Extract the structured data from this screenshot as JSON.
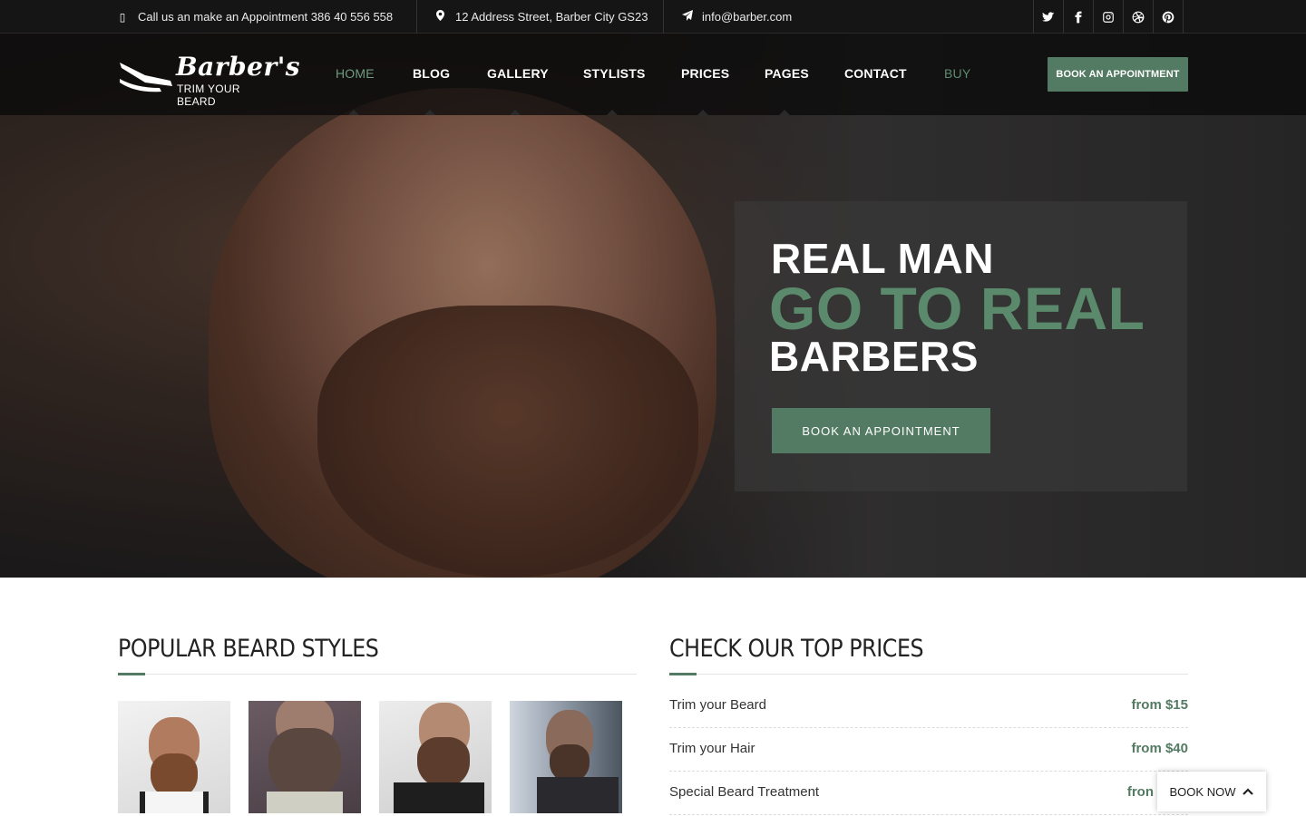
{
  "topbar": {
    "phone": "Call us an make an Appointment 386 40 556 558",
    "address": "12 Address Street, Barber City GS23",
    "email": "info@barber.com",
    "socials": [
      "twitter-icon",
      "facebook-icon",
      "instagram-icon",
      "dribbble-icon",
      "pinterest-icon"
    ]
  },
  "logo": {
    "brand": "Barber's",
    "tagline": "TRIM YOUR BEARD"
  },
  "nav": {
    "items": [
      {
        "label": "HOME",
        "active": true
      },
      {
        "label": "BLOG"
      },
      {
        "label": "GALLERY"
      },
      {
        "label": "STYLISTS"
      },
      {
        "label": "PRICES"
      },
      {
        "label": "PAGES"
      },
      {
        "label": "CONTACT"
      },
      {
        "label": "BUY"
      }
    ],
    "cta": "BOOK AN APPOINTMENT"
  },
  "hero": {
    "line1": "REAL MAN",
    "line2": "GO TO REAL",
    "line3": "BARBERS",
    "button": "BOOK AN APPOINTMENT"
  },
  "beard_styles": {
    "title": "POPULAR BEARD STYLES"
  },
  "prices": {
    "title": "CHECK OUR TOP PRICES",
    "rows": [
      {
        "service": "Trim your Beard",
        "price": "from $15"
      },
      {
        "service": "Trim your Hair",
        "price": "from $40"
      },
      {
        "service": "Special Beard Treatment",
        "price": "fron"
      }
    ]
  },
  "floating": {
    "book_now": "BOOK NOW"
  },
  "colors": {
    "accent": "#537a62",
    "accent_text": "#5a8a6b",
    "topbar_bg": "#151515"
  }
}
